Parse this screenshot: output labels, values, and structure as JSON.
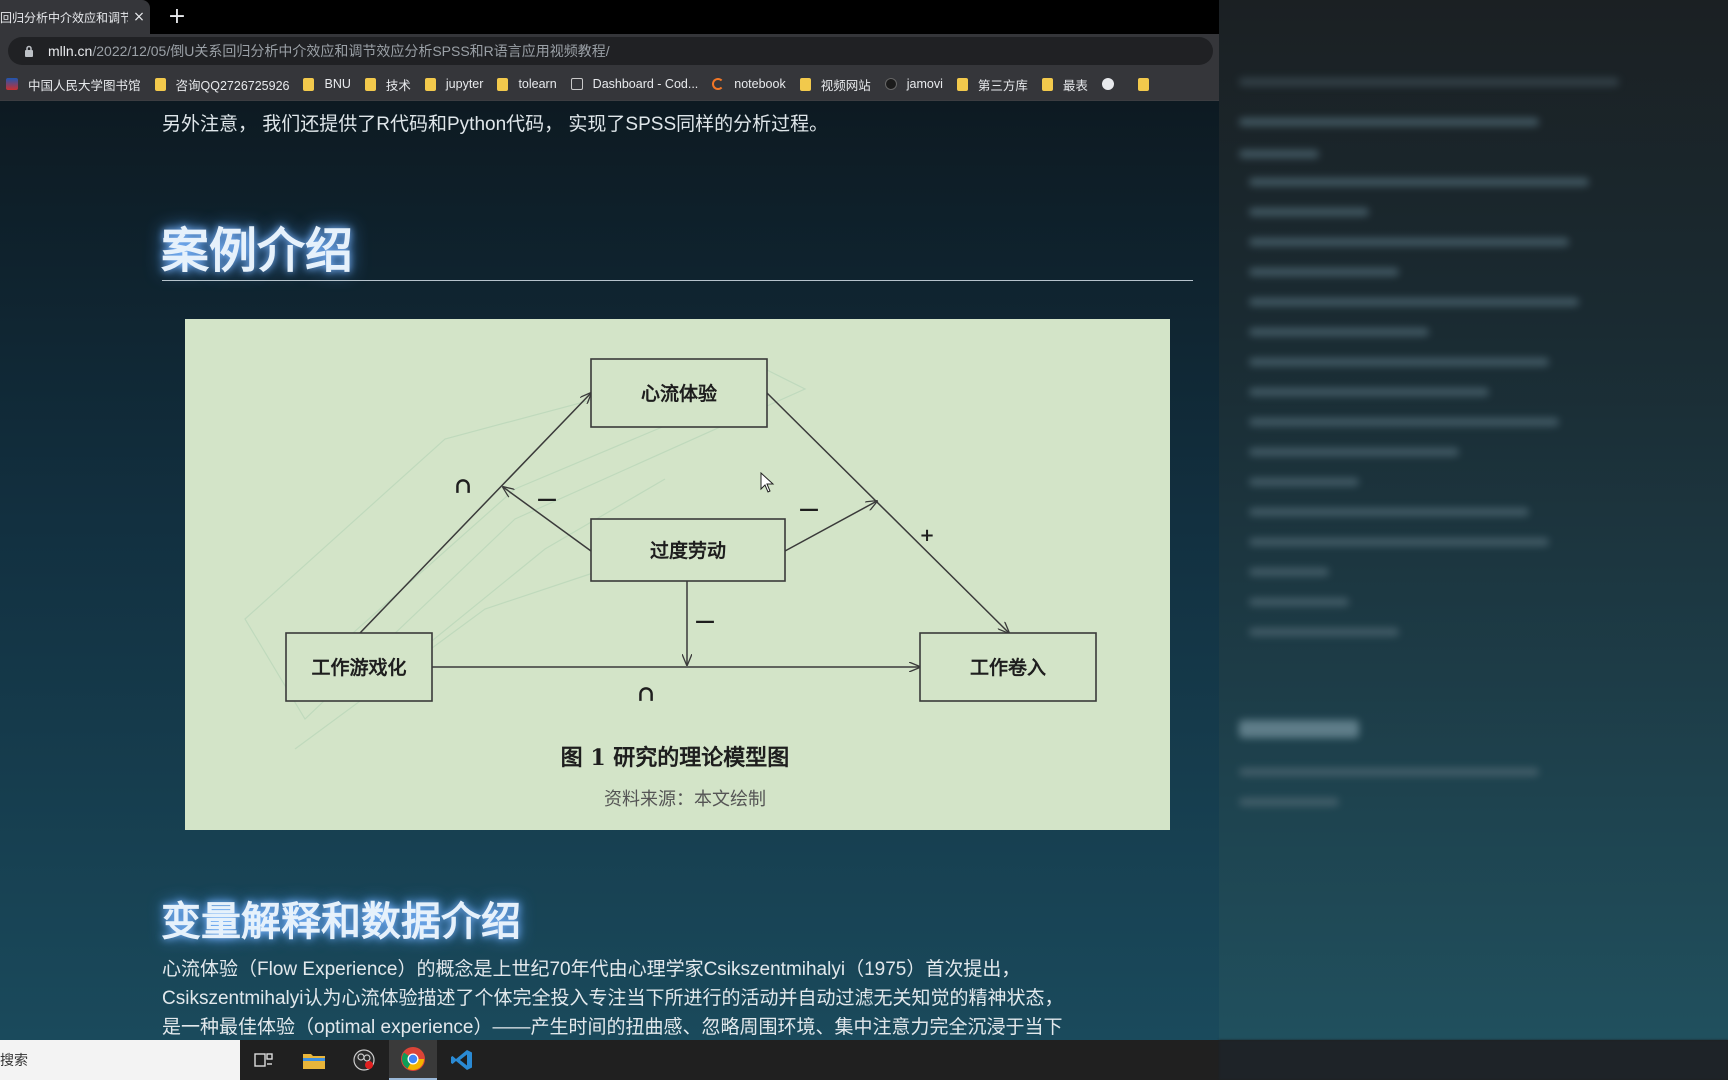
{
  "browser": {
    "tab_title": "回归分析中介效应和调节",
    "tab_close": "×",
    "new_tab": "+",
    "url_domain": "mlln.cn",
    "url_path": "/2022/12/05/倒U关系回归分析中介效应和调节效应分析SPSS和R语言应用视频教程/"
  },
  "bookmarks": [
    {
      "label": "中国人民大学图书馆",
      "icon": "library-icon"
    },
    {
      "label": "咨询QQ2726725926",
      "icon": "folder-icon"
    },
    {
      "label": "BNU",
      "icon": "folder-icon"
    },
    {
      "label": "技术",
      "icon": "folder-icon"
    },
    {
      "label": "jupyter",
      "icon": "folder-icon"
    },
    {
      "label": "tolearn",
      "icon": "folder-icon"
    },
    {
      "label": "Dashboard - Cod...",
      "icon": "square-icon"
    },
    {
      "label": "notebook",
      "icon": "jupyter-icon"
    },
    {
      "label": "视频网站",
      "icon": "folder-icon"
    },
    {
      "label": "jamovi",
      "icon": "github-icon"
    },
    {
      "label": "第三方库",
      "icon": "folder-icon"
    },
    {
      "label": "最表",
      "icon": "folder-icon"
    },
    {
      "label": "",
      "icon": "globe-icon"
    },
    {
      "label": "",
      "icon": "folder-icon"
    }
  ],
  "content": {
    "lead": "另外注意， 我们还提供了R代码和Python代码， 实现了SPSS同样的分析过程。",
    "heading1": "案例介绍",
    "heading2": "变量解释和数据介绍",
    "paragraph": [
      "心流体验（Flow Experience）的概念是上世纪70年代由心理学家Csikszentmihalyi（1975）首次提出，",
      "Csikszentmihalyi认为心流体验描述了个体完全投入专注当下所进行的活动并自动过滤无关知觉的精神状态，",
      "是一种最佳体验（optimal experience）——产生时间的扭曲感、忽略周围环境、集中注意力完全沉浸于当下"
    ]
  },
  "diagram": {
    "nodes": {
      "flow": "心流体验",
      "overwork": "过度劳动",
      "gamification": "工作游戏化",
      "engagement": "工作卷入"
    },
    "signs": {
      "gam_to_flow": "∩",
      "overwork_to_left": "—",
      "overwork_to_right": "—",
      "flow_to_engagement": "+",
      "overwork_down": "—",
      "gam_to_engagement": "∩"
    },
    "caption": "图 1  研究的理论模型图",
    "source": "资料来源：本文绘制"
  },
  "taskbar": {
    "search_placeholder": "搜索",
    "apps": [
      "task-view-icon",
      "file-explorer-icon",
      "obs-icon",
      "chrome-icon",
      "vscode-icon"
    ]
  }
}
